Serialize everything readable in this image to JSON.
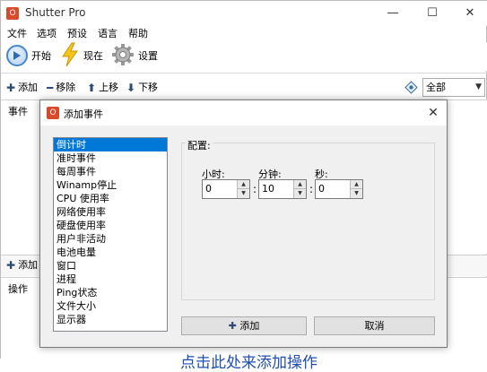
{
  "app": {
    "title": "Shutter Pro",
    "icon_letter": "O"
  },
  "window_controls": {
    "minimize": "—",
    "maximize": "☐",
    "close": "✕"
  },
  "menu": [
    "文件",
    "选项",
    "预设",
    "语言",
    "帮助"
  ],
  "toolbar": {
    "start_label": "开始",
    "now_label": "现在",
    "settings_label": "设置"
  },
  "actions": {
    "add_label": "添加",
    "remove_label": "移除",
    "up_label": "上移",
    "down_label": "下移"
  },
  "filter": {
    "selected": "全部"
  },
  "events_pane": {
    "header": "事件"
  },
  "lower_actions": {
    "add_label": "添加"
  },
  "actions_pane": {
    "header": "操作",
    "hint": "点击此处来添加操作"
  },
  "dialog": {
    "title": "添加事件",
    "close": "✕",
    "event_types": [
      "倒计时",
      "准时事件",
      "每周事件",
      "Winamp停止",
      "CPU 使用率",
      "网络使用率",
      "硬盘使用率",
      "用户非活动",
      "电池电量",
      "窗口",
      "进程",
      "Ping状态",
      "文件大小",
      "显示器"
    ],
    "selected_index": 0,
    "config_label": "配置:",
    "hours_label": "小时:",
    "minutes_label": "分钟:",
    "seconds_label": "秒:",
    "hours_value": "0",
    "minutes_value": "10",
    "seconds_value": "0",
    "add_button": "添加",
    "cancel_button": "取消"
  }
}
